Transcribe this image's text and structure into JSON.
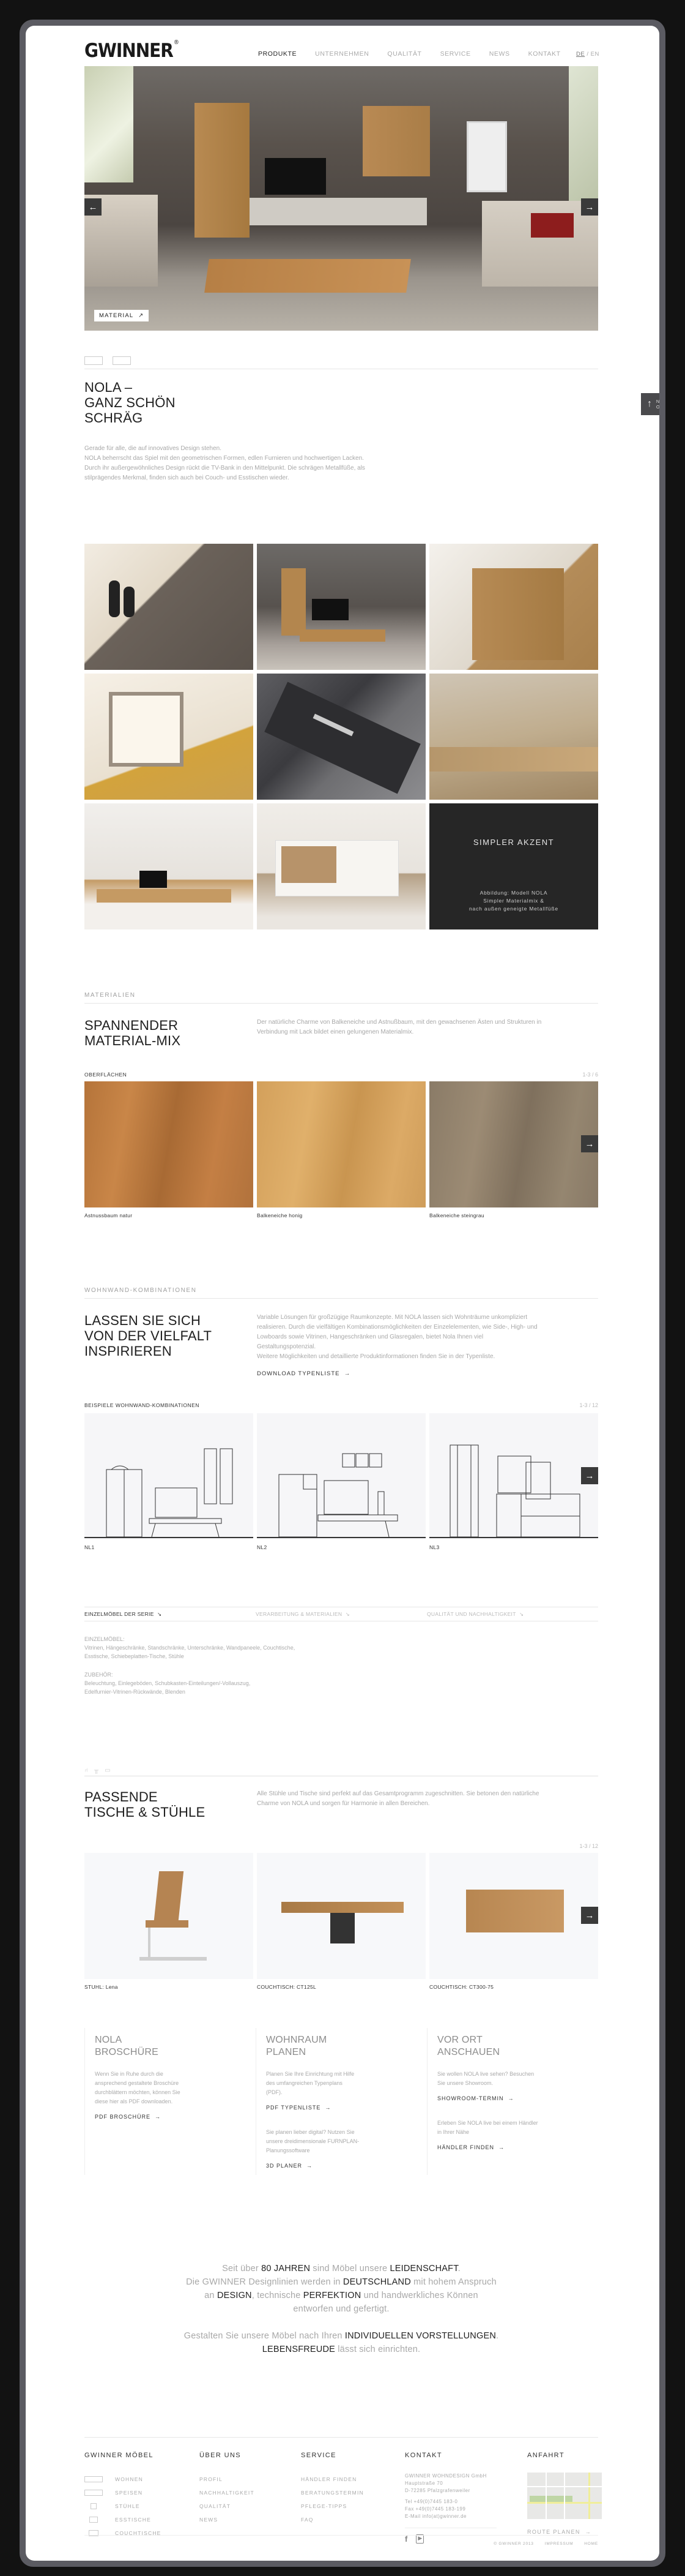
{
  "header": {
    "logo": "GWINNER",
    "logo_mark": "®",
    "nav": [
      {
        "label": "PRODUKTE",
        "active": true
      },
      {
        "label": "UNTERNEHMEN",
        "active": false
      },
      {
        "label": "QUALITÄT",
        "active": false
      },
      {
        "label": "SERVICE",
        "active": false
      },
      {
        "label": "NEWS",
        "active": false
      },
      {
        "label": "KONTAKT",
        "active": false
      }
    ],
    "lang_active": "DE",
    "lang_sep": " / ",
    "lang_other": "EN"
  },
  "hero": {
    "tag_label": "MATERIAL",
    "tag_icon": "arrow-up-right",
    "prev_icon": "←",
    "next_icon": "→"
  },
  "back_to_top": {
    "line1": "NACH",
    "line2": "OBEN",
    "icon": "↑"
  },
  "intro": {
    "title_lines": [
      "NOLA –",
      "GANZ SCHÖN",
      "SCHRÄG"
    ],
    "text_lines": [
      "Gerade für alle, die auf innovatives Design stehen.",
      "NOLA beherrscht das Spiel mit den geometrischen Formen, edlen Furnieren und hochwertigen Lacken. Durch ihr außergewöhnliches Design rückt die TV-Bank in den Mittelpunkt. Die schrägen Metallfüße, als stilprägendes Merkmal, finden sich auch bei Couch- und Esstischen wieder."
    ]
  },
  "gallery": {
    "feature_title": "SIMPLER AKZENT",
    "feature_caption": [
      "Abbildung: Modell NOLA",
      "Simpler Materialmix &",
      "nach außen geneigte Metallfüße"
    ]
  },
  "materials": {
    "section_label": "MATERIALIEN",
    "title_lines": [
      "SPANNENDER",
      "MATERIAL-MIX"
    ],
    "text": "Der natürliche Charme von Balkeneiche und Astnußbaum, mit den gewachsenen Ästen und Strukturen in Verbindung mit Lack bildet einen gelungenen Materialmix.",
    "list_label": "OBERFLÄCHEN",
    "counter": "1-3 / 6",
    "items": [
      "Astnussbaum natur",
      "Balkeneiche honig",
      "Balkeneiche steingrau"
    ],
    "next_icon": "→"
  },
  "combos": {
    "section_label": "WOHNWAND-KOMBINATIONEN",
    "title_lines": [
      "LASSEN SIE SICH",
      "VON DER VIELFALT",
      "INSPIRIEREN"
    ],
    "text_lines": [
      "Variable Lösungen für großzügige Raumkonzepte. Mit NOLA lassen sich Wohnträume unkompliziert realisieren. Durch die vielfältigen Kombinationsmöglichkeiten der Einzelelementen, wie Side-, High- und Lowboards sowie Vitrinen, Hangeschränken und Glasregalen, bietet Nola Ihnen viel Gestaltungspotenzial.",
      "Weitere Möglichkeiten und detaillierte Produktinformationen finden Sie in der Typenliste."
    ],
    "download_label": "DOWNLOAD TYPENLISTE",
    "list_label": "BEISPIELE WOHNWAND-KOMBINATIONEN",
    "counter": "1-3 / 12",
    "items": [
      "NL1",
      "NL2",
      "NL3"
    ],
    "next_icon": "→"
  },
  "tabs": {
    "items": [
      {
        "label": "EINZELMÖBEL DER SERIE",
        "active": true
      },
      {
        "label": "VERARBEITUNG & MATERIALIEN",
        "active": false
      },
      {
        "label": "QUALITÄT UND NACHHALTIGKEIT",
        "active": false
      }
    ],
    "icon": "↘",
    "einzel_label": "EINZELMÖBEL:",
    "einzel_lines": [
      "Vitrinen, Hängeschränke, Standschränke, Unterschränke, Wandpaneele, Couchtische,",
      "Esstische, Schiebeplatten-Tische, Stühle"
    ],
    "zubehoer_label": "ZUBEHÖR:",
    "zubehoer_lines": [
      "Beleuchtung, Einlegeböden, Schubkasten-Einteilungen/-Vollauszug,",
      "Edelfurnier-Vitrinen-Rückwände, Blenden"
    ]
  },
  "tables": {
    "title_lines": [
      "PASSENDE",
      "TISCHE & STÜHLE"
    ],
    "text": "Alle Stühle und Tische sind perfekt auf das Gesamtprogramm zugeschnitten. Sie betonen den natürliche Charme von NOLA und sorgen für Harmonie in allen Bereichen.",
    "counter": "1-3 / 12",
    "items": [
      "STUHL: Lena",
      "COUCHTISCH: CT125L",
      "COUCHTISCH: CT300-75"
    ],
    "next_icon": "→"
  },
  "cta": [
    {
      "title_lines": [
        "NOLA",
        "BROSCHÜRE"
      ],
      "blocks": [
        {
          "text": "Wenn Sie in Ruhe durch die ansprechend gestaltete Broschüre durchblättern möchten, können Sie diese hier als PDF downloaden.",
          "link": "PDF BROSCHÜRE"
        }
      ]
    },
    {
      "title_lines": [
        "WOHNRAUM",
        "PLANEN"
      ],
      "blocks": [
        {
          "text": "Planen Sie Ihre Einrichtung mit Hilfe des umfangreichen Typenplans (PDF).",
          "link": "PDF TYPENLISTE"
        },
        {
          "text": "Sie planen lieber digital? Nutzen Sie unsere dreidimensionale FURNPLAN-Planungssoftware",
          "link": "3D PLANER"
        }
      ]
    },
    {
      "title_lines": [
        "VOR ORT",
        "ANSCHAUEN"
      ],
      "blocks": [
        {
          "text": "Sie wollen NOLA live sehen? Besuchen Sie unsere Showroom.",
          "link": "SHOWROOM-TERMIN"
        },
        {
          "text": "Erleben Sie NOLA live bei einem Händler in Ihrer Nähe",
          "link": "HÄNDLER FINDEN"
        }
      ]
    }
  ],
  "claim": {
    "p1": [
      {
        "t": "Seit über ",
        "b": false
      },
      {
        "t": "80 JAHREN",
        "b": true
      },
      {
        "t": " sind Möbel unsere ",
        "b": false
      },
      {
        "t": "LEIDENSCHAFT",
        "b": true
      },
      {
        "t": ".",
        "b": false
      },
      {
        "t": "Die GWINNER Designlinien werden in ",
        "b": false,
        "br": true
      },
      {
        "t": "DEUTSCHLAND",
        "b": true
      },
      {
        "t": " mit hohem Anspruch",
        "b": false
      },
      {
        "t": "an ",
        "b": false,
        "br": true
      },
      {
        "t": "DESIGN",
        "b": true
      },
      {
        "t": ", technische ",
        "b": false
      },
      {
        "t": "PERFEKTION",
        "b": true
      },
      {
        "t": " und handwerkliches Können",
        "b": false
      },
      {
        "t": "entworfen und gefertigt.",
        "b": false,
        "br": true
      }
    ],
    "p2": [
      {
        "t": "Gestalten Sie unsere Möbel nach Ihren ",
        "b": false
      },
      {
        "t": "INDIVIDUELLEN VORSTELLUNGEN",
        "b": true
      },
      {
        "t": ".",
        "b": false
      },
      {
        "t": "LEBENSFREUDE",
        "b": true,
        "br": true
      },
      {
        "t": " lässt sich einrichten.",
        "b": false
      }
    ]
  },
  "footer": {
    "col1": {
      "title": "GWINNER MÖBEL",
      "items": [
        "WOHNEN",
        "SPEISEN",
        "STÜHLE",
        "ESSTISCHE",
        "COUCHTISCHE"
      ]
    },
    "col2": {
      "title": "ÜBER UNS",
      "items": [
        "PROFIL",
        "NACHHALTIGKEIT",
        "QUALITÄT",
        "NEWS"
      ]
    },
    "col3": {
      "title": "SERVICE",
      "items": [
        "HÄNDLER FINDEN",
        "BERATUNGSTERMIN",
        "PFLEGE-TIPPS",
        "FAQ"
      ]
    },
    "col4": {
      "title": "KONTAKT",
      "address": [
        "GWINNER WOHNDESIGN GmbH",
        "Hauptstraße 70",
        "D-72285 Pfalzgrafenweiler"
      ],
      "contact": [
        "Tel  +49(0)7445 183-0",
        "Fax +49(0)7445 183-199",
        "E-Mail info(at)gwinner.de"
      ],
      "social": [
        "facebook",
        "youtube"
      ]
    },
    "col5": {
      "title": "ANFAHRT",
      "route": "ROUTE PLANEN"
    },
    "bottom": [
      "© GWINNER 2013",
      "IMPRESSUM",
      "HOME"
    ]
  },
  "colors": {
    "accent_dark": "#3a3a3a",
    "text_gray": "#a8a8a8",
    "frame": "#5b5b62"
  }
}
